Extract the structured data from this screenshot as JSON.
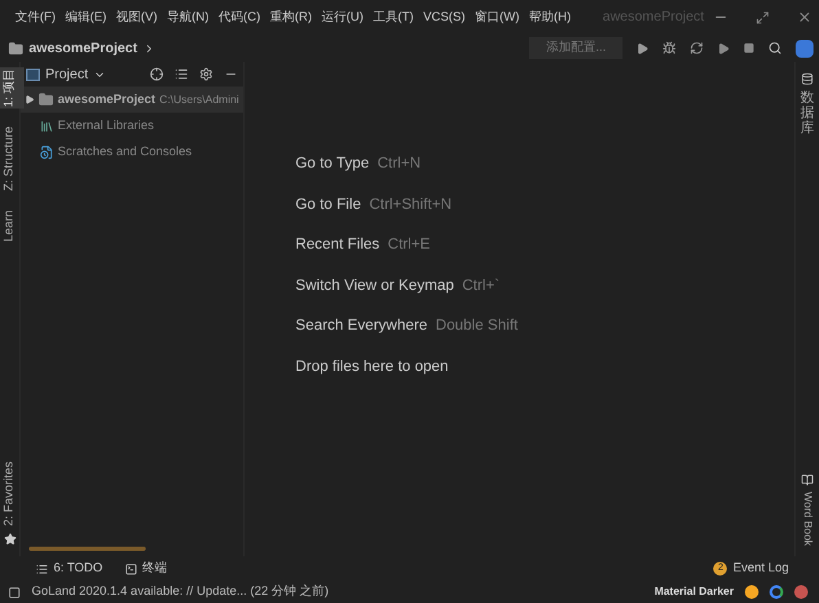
{
  "menu": [
    "文件(F)",
    "编辑(E)",
    "视图(V)",
    "导航(N)",
    "代码(C)",
    "重构(R)",
    "运行(U)",
    "工具(T)",
    "VCS(S)",
    "窗口(W)",
    "帮助(H)"
  ],
  "window": {
    "title": "awesomeProject"
  },
  "breadcrumb": "awesomeProject",
  "toolbar": {
    "config_button": "添加配置..."
  },
  "left_strip": [
    {
      "label": "1: 项目",
      "selected": true
    },
    {
      "label": "Z: Structure",
      "selected": false
    },
    {
      "label": "Learn",
      "selected": false
    },
    {
      "label": "2: Favorites",
      "selected": false
    }
  ],
  "right_strip": [
    {
      "label": "数据库"
    },
    {
      "label": "Word Book"
    }
  ],
  "project_panel": {
    "title": "Project",
    "tree": [
      {
        "name": "awesomeProject",
        "path": "C:\\Users\\Admini",
        "selected": true,
        "expanded": false,
        "kind": "folder"
      },
      {
        "name": "External Libraries",
        "kind": "library"
      },
      {
        "name": "Scratches and Consoles",
        "kind": "scratch"
      }
    ]
  },
  "hints": [
    {
      "action": "Go to Type",
      "shortcut": "Ctrl+N"
    },
    {
      "action": "Go to File",
      "shortcut": "Ctrl+Shift+N"
    },
    {
      "action": "Recent Files",
      "shortcut": "Ctrl+E"
    },
    {
      "action": "Switch View or Keymap",
      "shortcut": "Ctrl+`"
    },
    {
      "action": "Search Everywhere",
      "shortcut": "Double Shift"
    },
    {
      "action": "Drop files here to open"
    }
  ],
  "progress": {
    "level": 1
  },
  "bottom_tools": [
    {
      "label": "6: TODO",
      "kind": "list"
    },
    {
      "label": "终端",
      "kind": "terminal"
    }
  ],
  "event_log": {
    "count": "2",
    "label": "Event Log"
  },
  "status_bar": {
    "message": "GoLand 2020.1.4 available: // Update... (22 分钟 之前)",
    "theme": "Material Darker"
  }
}
